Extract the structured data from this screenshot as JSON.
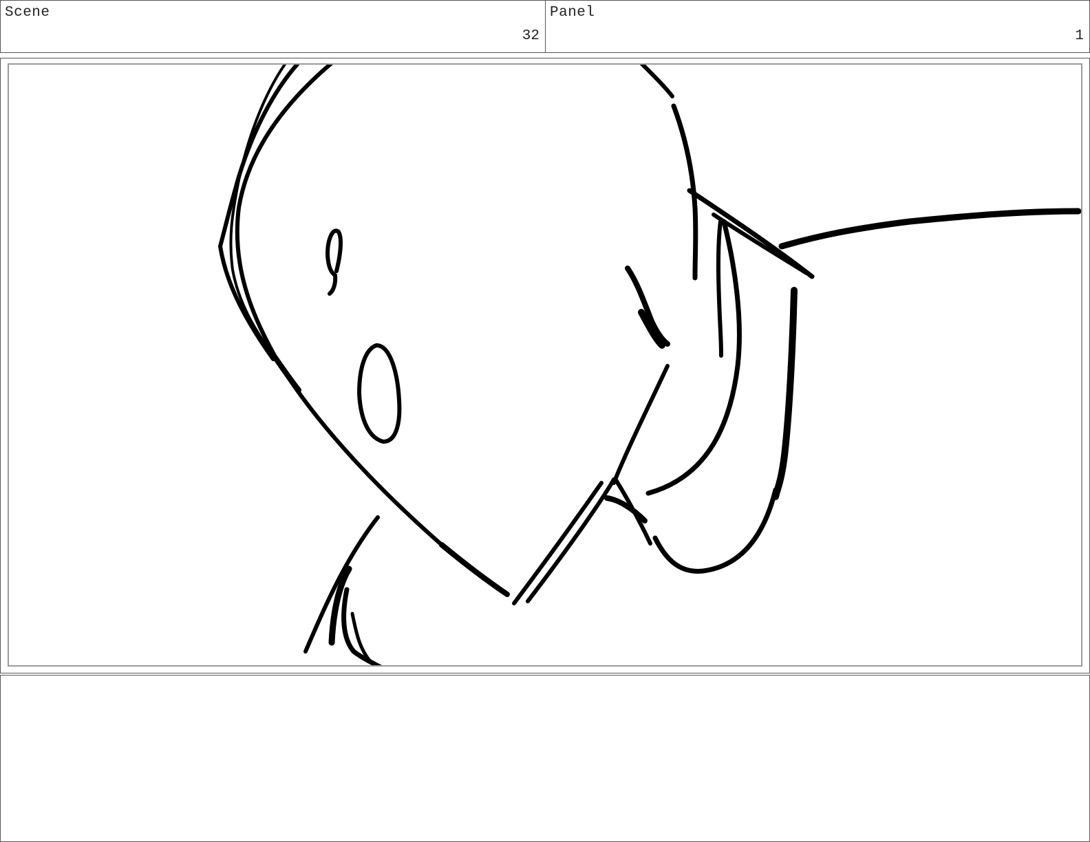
{
  "header": {
    "scene": {
      "label": "Scene",
      "value": "32"
    },
    "panel": {
      "label": "Panel",
      "value": "1"
    }
  },
  "frame": {
    "sketch": "rough line drawing of a character face",
    "stroke_color": "#000000",
    "border_color": "#9a9a9a"
  },
  "notes": {
    "text": ""
  }
}
